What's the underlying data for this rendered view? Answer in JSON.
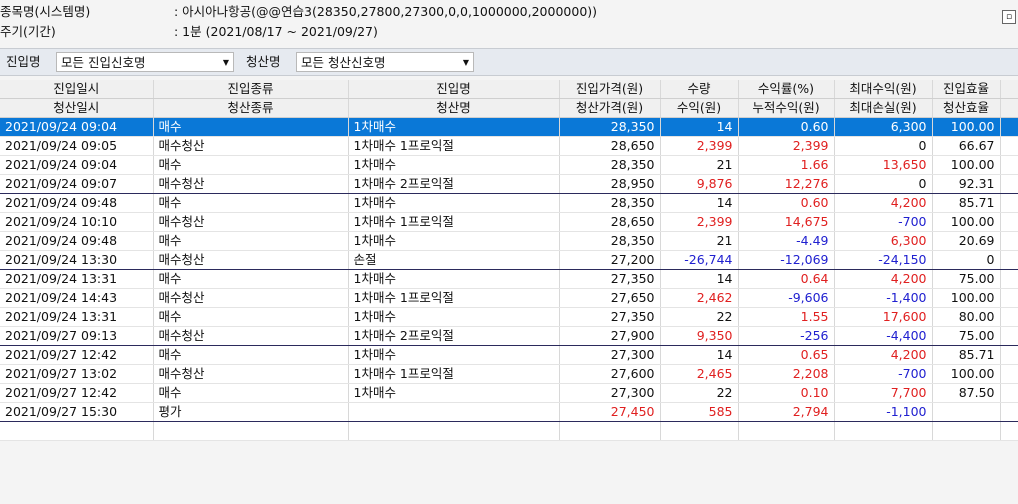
{
  "info": {
    "symbol_label": "종목명(시스템명)",
    "symbol_value": ": 아시아나항공(@@연습3(28350,27800,27300,0,0,1000000,2000000))",
    "period_label": "주기(기간)",
    "period_value": ": 1분 (2021/08/17 ~ 2021/09/27)"
  },
  "filters": {
    "entry_label": "진입명",
    "entry_value": "모든 진입신호명",
    "exit_label": "청산명",
    "exit_value": "모든 청산신호명"
  },
  "headers": {
    "row1": [
      "진입일시",
      "진입종류",
      "진입명",
      "진입가격(원)",
      "수량",
      "수익률(%)",
      "최대수익(원)",
      "진입효율"
    ],
    "row2": [
      "청산일시",
      "청산종류",
      "청산명",
      "청산가격(원)",
      "수익(원)",
      "누적수익(원)",
      "최대손실(원)",
      "청산효율"
    ]
  },
  "rows": [
    {
      "dt": "2021/09/24 09:04",
      "kind": "매수",
      "name": "1차매수",
      "price": "28,350",
      "qty": "14",
      "ret": "0.60",
      "max": "6,300",
      "eff": "100.00",
      "sel": true
    },
    {
      "dt": "2021/09/24 09:05",
      "kind": "매수청산",
      "name": "1차매수 1프로익절",
      "price": "28,650",
      "qty": "2,399",
      "ret": "2,399",
      "max": "0",
      "eff": "66.67"
    },
    {
      "dt": "2021/09/24 09:04",
      "kind": "매수",
      "name": "1차매수",
      "price": "28,350",
      "qty": "21",
      "ret": "1.66",
      "max": "13,650",
      "eff": "100.00"
    },
    {
      "dt": "2021/09/24 09:07",
      "kind": "매수청산",
      "name": "1차매수 2프로익절",
      "price": "28,950",
      "qty": "9,876",
      "ret": "12,276",
      "max": "0",
      "eff": "92.31",
      "end": true
    },
    {
      "dt": "2021/09/24 09:48",
      "kind": "매수",
      "name": "1차매수",
      "price": "28,350",
      "qty": "14",
      "ret": "0.60",
      "max": "4,200",
      "eff": "85.71"
    },
    {
      "dt": "2021/09/24 10:10",
      "kind": "매수청산",
      "name": "1차매수 1프로익절",
      "price": "28,650",
      "qty": "2,399",
      "ret": "14,675",
      "max": "-700",
      "eff": "100.00"
    },
    {
      "dt": "2021/09/24 09:48",
      "kind": "매수",
      "name": "1차매수",
      "price": "28,350",
      "qty": "21",
      "ret": "-4.49",
      "max": "6,300",
      "eff": "20.69"
    },
    {
      "dt": "2021/09/24 13:30",
      "kind": "매수청산",
      "name": "손절",
      "price": "27,200",
      "qty": "-26,744",
      "ret": "-12,069",
      "max": "-24,150",
      "eff": "0",
      "end": true
    },
    {
      "dt": "2021/09/24 13:31",
      "kind": "매수",
      "name": "1차매수",
      "price": "27,350",
      "qty": "14",
      "ret": "0.64",
      "max": "4,200",
      "eff": "75.00"
    },
    {
      "dt": "2021/09/24 14:43",
      "kind": "매수청산",
      "name": "1차매수 1프로익절",
      "price": "27,650",
      "qty": "2,462",
      "ret": "-9,606",
      "max": "-1,400",
      "eff": "100.00"
    },
    {
      "dt": "2021/09/24 13:31",
      "kind": "매수",
      "name": "1차매수",
      "price": "27,350",
      "qty": "22",
      "ret": "1.55",
      "max": "17,600",
      "eff": "80.00"
    },
    {
      "dt": "2021/09/27 09:13",
      "kind": "매수청산",
      "name": "1차매수 2프로익절",
      "price": "27,900",
      "qty": "9,350",
      "ret": "-256",
      "max": "-4,400",
      "eff": "75.00",
      "end": true
    },
    {
      "dt": "2021/09/27 12:42",
      "kind": "매수",
      "name": "1차매수",
      "price": "27,300",
      "qty": "14",
      "ret": "0.65",
      "max": "4,200",
      "eff": "85.71"
    },
    {
      "dt": "2021/09/27 13:02",
      "kind": "매수청산",
      "name": "1차매수 1프로익절",
      "price": "27,600",
      "qty": "2,465",
      "ret": "2,208",
      "max": "-700",
      "eff": "100.00"
    },
    {
      "dt": "2021/09/27 12:42",
      "kind": "매수",
      "name": "1차매수",
      "price": "27,300",
      "qty": "22",
      "ret": "0.10",
      "max": "7,700",
      "eff": "87.50"
    },
    {
      "dt": "2021/09/27 15:30",
      "kind": "평가",
      "name": "",
      "price": "27,450",
      "qty": "585",
      "ret": "2,794",
      "max": "-1,100",
      "eff": "",
      "end": true,
      "price_red": true
    }
  ],
  "colors": {
    "positive": "#e02020",
    "negative": "#2020d0",
    "selected": "#0a78d7"
  }
}
